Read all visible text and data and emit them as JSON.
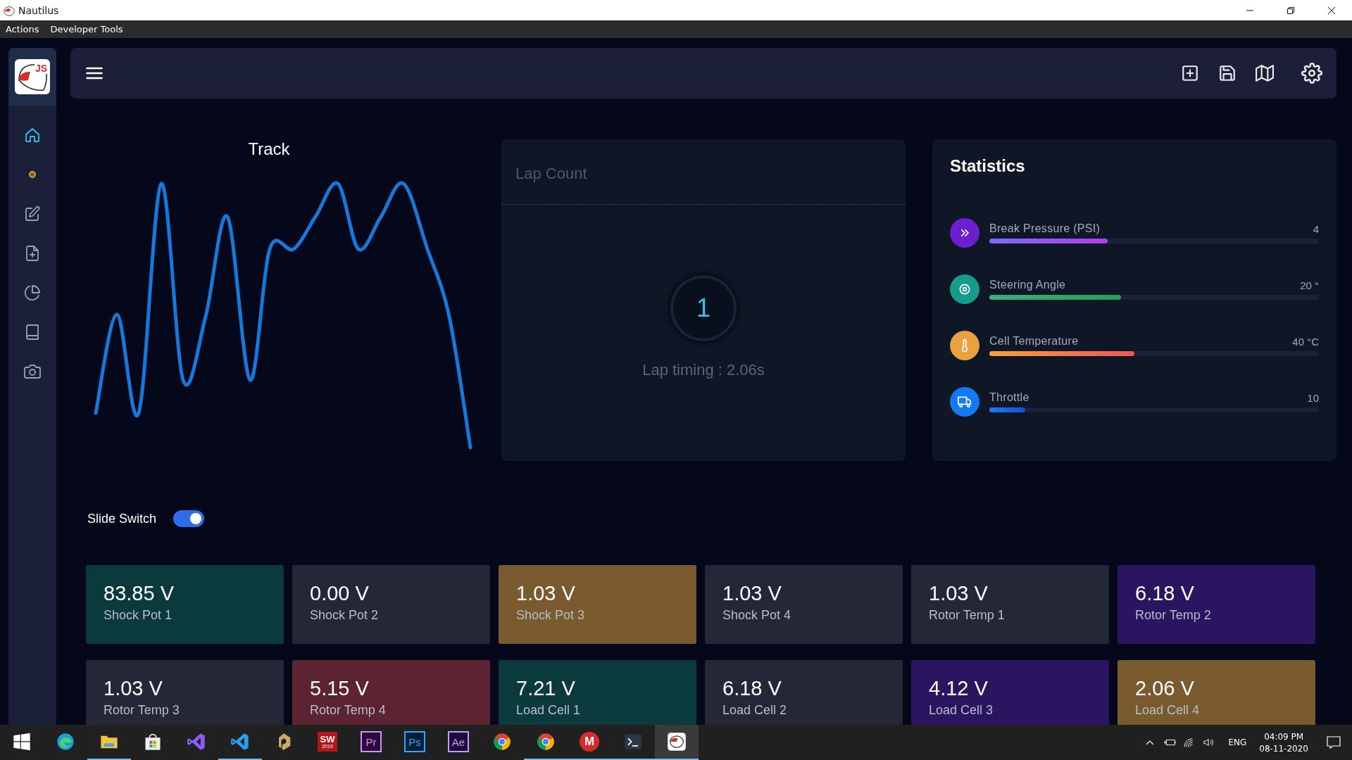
{
  "window": {
    "title": "Nautilus"
  },
  "menu": [
    "Actions",
    "Developer Tools"
  ],
  "sidebar": {
    "logo": "JS",
    "items": [
      {
        "kind": "home",
        "selected": true
      },
      {
        "kind": "dot",
        "selected": false
      },
      {
        "kind": "edit",
        "selected": false
      },
      {
        "kind": "file",
        "selected": false
      },
      {
        "kind": "pie",
        "selected": false
      },
      {
        "kind": "book",
        "selected": false
      },
      {
        "kind": "camera",
        "selected": false
      }
    ]
  },
  "track": {
    "title": "Track"
  },
  "lap": {
    "title": "Lap Count",
    "count": "1",
    "timing": "Lap timing : 2.06s"
  },
  "statistics": {
    "title": "Statistics",
    "items": [
      {
        "kind": "pressure",
        "name": "Break Pressure (PSI)",
        "value": "4",
        "level": 0.36,
        "color": "#6a1fd0"
      },
      {
        "kind": "steering",
        "name": "Steering Angle",
        "value": "20 °",
        "level": 0.4,
        "color": "#149e8a"
      },
      {
        "kind": "temperature",
        "name": "Cell Temperature",
        "value": "40 °C",
        "level": 0.44,
        "color": "#e8a23e"
      },
      {
        "kind": "throttle",
        "name": "Throttle",
        "value": "10",
        "level": 0.11,
        "color": "#1479f5"
      }
    ]
  },
  "switch": {
    "label": "Slide Switch",
    "on": true
  },
  "tiles": [
    {
      "value": "83.85 V",
      "label": "Shock Pot 1",
      "color": "#0b3a3d"
    },
    {
      "value": "0.00 V",
      "label": "Shock Pot 2",
      "color": "#252736"
    },
    {
      "value": "1.03 V",
      "label": "Shock Pot 3",
      "color": "#7a5a2f"
    },
    {
      "value": "1.03 V",
      "label": "Shock Pot 4",
      "color": "#252736"
    },
    {
      "value": "1.03 V",
      "label": "Rotor Temp 1",
      "color": "#252736"
    },
    {
      "value": "6.18 V",
      "label": "Rotor Temp 2",
      "color": "#2a1660"
    },
    {
      "value": "1.03 V",
      "label": "Rotor Temp 3",
      "color": "#252736"
    },
    {
      "value": "5.15 V",
      "label": "Rotor Temp 4",
      "color": "#5c2332"
    },
    {
      "value": "7.21 V",
      "label": "Load Cell 1",
      "color": "#0b3a3d"
    },
    {
      "value": "6.18 V",
      "label": "Load Cell 2",
      "color": "#252736"
    },
    {
      "value": "4.12 V",
      "label": "Load Cell 3",
      "color": "#2a1660"
    },
    {
      "value": "2.06 V",
      "label": "Load Cell 4",
      "color": "#7a5a2f"
    }
  ],
  "taskbar": {
    "apps": [
      {
        "kind": "start",
        "running": false,
        "selected": false
      },
      {
        "kind": "edge",
        "running": false,
        "selected": false
      },
      {
        "kind": "folder",
        "running": true,
        "selected": false
      },
      {
        "kind": "store",
        "running": false,
        "selected": false
      },
      {
        "kind": "vs",
        "running": false,
        "selected": false
      },
      {
        "kind": "vscode",
        "running": true,
        "selected": false
      },
      {
        "kind": "gold",
        "running": false,
        "selected": false
      },
      {
        "kind": "sw",
        "label": "SW",
        "sublabel": "2019",
        "running": false,
        "selected": false
      },
      {
        "kind": "tile",
        "label": "Pr",
        "running": false,
        "selected": false
      },
      {
        "kind": "tile",
        "label": "Ps",
        "running": false,
        "selected": false
      },
      {
        "kind": "tile",
        "label": "Ae",
        "running": false,
        "selected": false
      },
      {
        "kind": "chrome",
        "running": false,
        "selected": false
      },
      {
        "kind": "chrome",
        "running": true,
        "selected": false
      },
      {
        "kind": "mail",
        "label": "M",
        "running": true,
        "selected": false
      },
      {
        "kind": "terminal",
        "running": true,
        "selected": false
      },
      {
        "kind": "nautilus",
        "running": true,
        "selected": true
      }
    ],
    "language": "ENG",
    "time": "04:09 PM",
    "date": "08-11-2020"
  }
}
